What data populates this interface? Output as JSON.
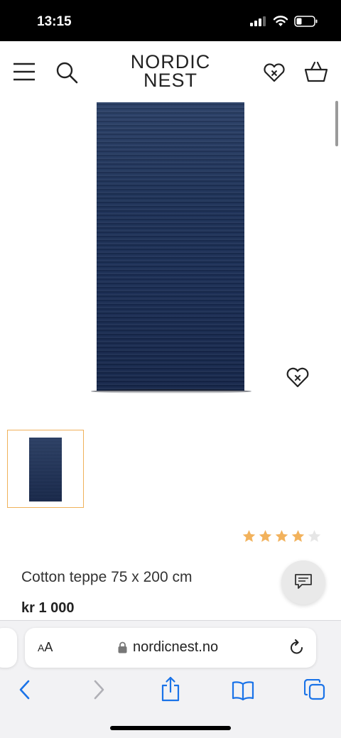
{
  "status_bar": {
    "time": "13:15",
    "icons": [
      "cellular-signal-icon",
      "wifi-icon",
      "battery-icon"
    ]
  },
  "header": {
    "logo_line1": "NORDIC",
    "logo_line2": "NEST",
    "icons": [
      "menu-icon",
      "search-icon",
      "wishlist-icon",
      "cart-icon"
    ]
  },
  "product": {
    "title": "Cotton teppe 75 x 200 cm",
    "price": "kr 1 000",
    "rating": 4,
    "rating_max": 5,
    "image_color": "#1d3157",
    "thumbnail_selected_color": "#f0b15a",
    "star_color": "#f2b25c"
  },
  "browser": {
    "text_size_label_small": "A",
    "text_size_label_large": "A",
    "url": "nordicnest.no",
    "toolbar_icons": [
      "back-icon",
      "forward-icon",
      "share-icon",
      "bookmarks-icon",
      "tabs-icon"
    ],
    "accent_color": "#1a73e8"
  }
}
